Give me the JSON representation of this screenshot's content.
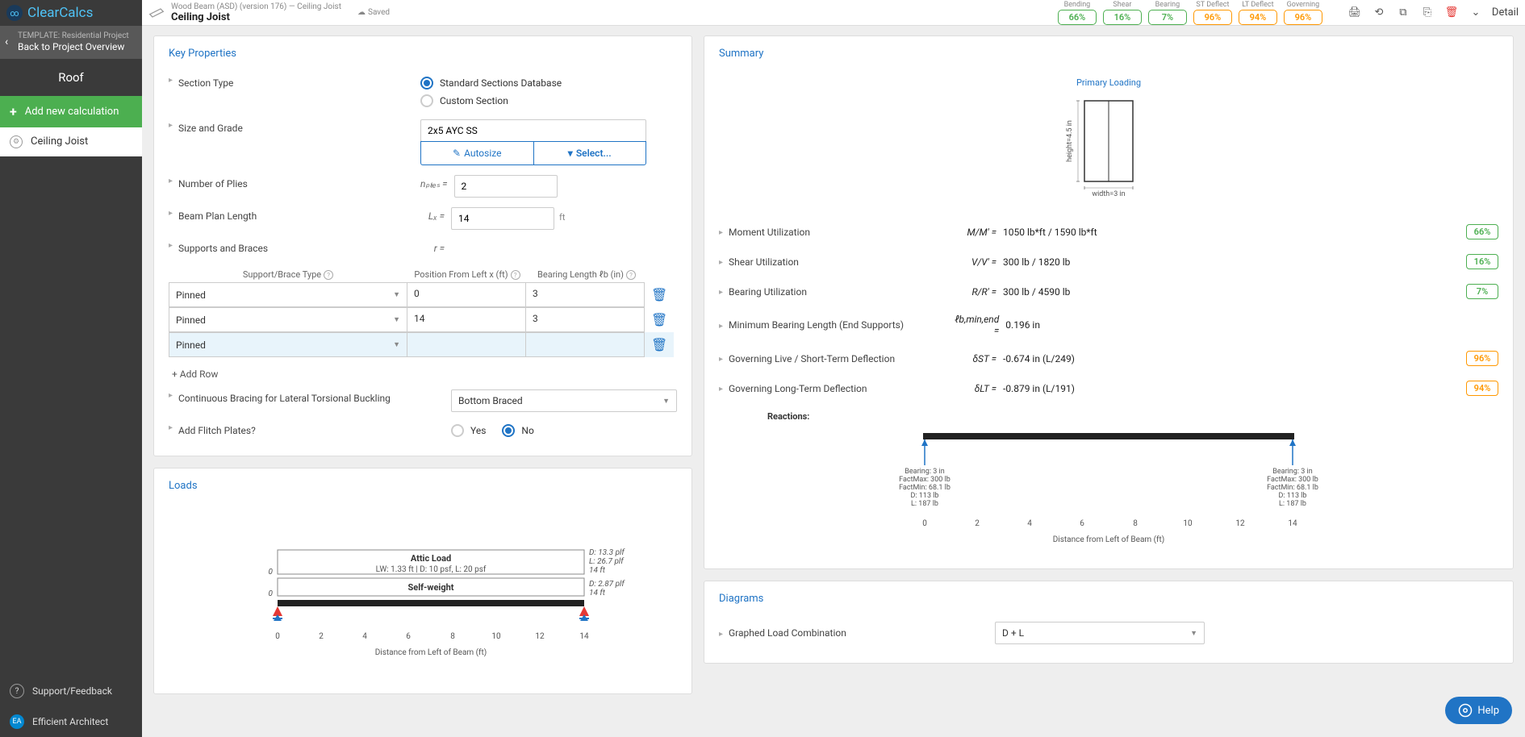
{
  "app": {
    "logo": "ClearCalcs"
  },
  "sidebar": {
    "template_label": "TEMPLATE: Residential Project",
    "back_label": "Back to Project Overview",
    "section_title": "Roof",
    "add_calc_label": "Add new calculation",
    "item_label": "Ceiling Joist",
    "support_label": "Support/Feedback",
    "user_label": "Efficient Architect",
    "user_initials": "EA"
  },
  "topbar": {
    "crumb": "Wood Beam (ASD) (version 176) — Ceiling Joist",
    "title": "Ceiling Joist",
    "saved": "Saved",
    "detail": "Detail",
    "utils": [
      {
        "label": "Bending",
        "value": "66%",
        "cls": "green"
      },
      {
        "label": "Shear",
        "value": "16%",
        "cls": "green"
      },
      {
        "label": "Bearing",
        "value": "7%",
        "cls": "green"
      },
      {
        "label": "ST Deflect",
        "value": "96%",
        "cls": "orange"
      },
      {
        "label": "LT Deflect",
        "value": "94%",
        "cls": "orange"
      },
      {
        "label": "Governing",
        "value": "96%",
        "cls": "orange"
      }
    ]
  },
  "key_props": {
    "title": "Key Properties",
    "section_type_label": "Section Type",
    "radio_std": "Standard Sections Database",
    "radio_custom": "Custom Section",
    "size_grade_label": "Size and Grade",
    "size_value": "2x5 AYC SS",
    "autosize_label": "Autosize",
    "select_label": "Select...",
    "plies_label": "Number of Plies",
    "plies_sym": "nₚₗᵢₑₛ =",
    "plies_value": "2",
    "length_label": "Beam Plan Length",
    "length_sym": "Lₓ =",
    "length_value": "14",
    "length_unit": "ft",
    "supports_label": "Supports and Braces",
    "supports_sym": "r =",
    "col_type": "Support/Brace Type",
    "col_pos": "Position From Left x (ft)",
    "col_bear": "Bearing Length ℓb (in)",
    "rows": [
      {
        "type": "Pinned",
        "pos": "0",
        "bear": "3"
      },
      {
        "type": "Pinned",
        "pos": "14",
        "bear": "3"
      },
      {
        "type": "Pinned",
        "pos": "",
        "bear": ""
      }
    ],
    "add_row": "+ Add Row",
    "bracing_label": "Continuous Bracing for Lateral Torsional Buckling",
    "bracing_value": "Bottom Braced",
    "flitch_label": "Add Flitch Plates?",
    "flitch_yes": "Yes",
    "flitch_no": "No"
  },
  "loads": {
    "title": "Loads",
    "attic_title": "Attic Load",
    "attic_sub": "LW: 1.33 ft | D: 10 psf, L: 20 psf",
    "attic_d": "D: 13.3 plf",
    "attic_l": "L: 26.7 plf",
    "attic_len": "14 ft",
    "sw_title": "Self-weight",
    "sw_d": "D: 2.87 plf",
    "sw_len": "14 ft",
    "xaxis_label": "Distance from Left of Beam (ft)",
    "zero_left": "0",
    "zero_right": "0",
    "ticks": [
      "0",
      "2",
      "4",
      "6",
      "8",
      "10",
      "12",
      "14"
    ]
  },
  "summary": {
    "title": "Summary",
    "primary_loading": "Primary Loading",
    "height_label": "height=4.5 in",
    "width_label": "width=3 in",
    "rows": [
      {
        "label": "Moment Utilization",
        "formula": "M/M' =",
        "value": "1050 lb*ft / 1590 lb*ft",
        "badge": "66%",
        "cls": "green"
      },
      {
        "label": "Shear Utilization",
        "formula": "V/V' =",
        "value": "300 lb / 1820 lb",
        "badge": "16%",
        "cls": "green"
      },
      {
        "label": "Bearing Utilization",
        "formula": "R/R' =",
        "value": "300 lb / 4590 lb",
        "badge": "7%",
        "cls": "green"
      },
      {
        "label": "Minimum Bearing Length (End Supports)",
        "formula": "ℓb,min,end =",
        "value": "0.196 in",
        "badge": "",
        "cls": ""
      },
      {
        "label": "Governing Live / Short-Term Deflection",
        "formula": "δST =",
        "value": "-0.674 in (L/249)",
        "badge": "96%",
        "cls": "orange"
      },
      {
        "label": "Governing Long-Term Deflection",
        "formula": "δLT =",
        "value": "-0.879 in (L/191)",
        "badge": "94%",
        "cls": "orange"
      }
    ],
    "reactions_title": "Reactions:",
    "react_left": {
      "l1": "Bearing: 3 in",
      "l2": "FactMax: 300 lb",
      "l3": "FactMin: 68.1 lb",
      "l4": "D: 113 lb",
      "l5": "L: 187 lb"
    },
    "react_right": {
      "l1": "Bearing: 3 in",
      "l2": "FactMax: 300 lb",
      "l3": "FactMin: 68.1 lb",
      "l4": "D: 113 lb",
      "l5": "L: 187 lb"
    },
    "react_ticks": [
      "0",
      "2",
      "4",
      "6",
      "8",
      "10",
      "12",
      "14"
    ],
    "react_xlabel": "Distance from Left of Beam (ft)"
  },
  "diagrams": {
    "title": "Diagrams",
    "combo_label": "Graphed Load Combination",
    "combo_value": "D + L"
  },
  "help": "Help"
}
